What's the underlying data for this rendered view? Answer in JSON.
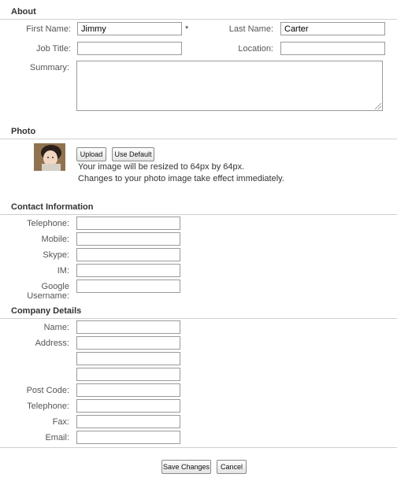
{
  "about": {
    "title": "About",
    "first_name_label": "First Name:",
    "first_name_value": "Jimmy",
    "required_mark": "*",
    "last_name_label": "Last Name:",
    "last_name_value": "Carter",
    "job_title_label": "Job Title:",
    "location_label": "Location:",
    "summary_label": "Summary:"
  },
  "photo": {
    "title": "Photo",
    "upload_label": "Upload",
    "use_default_label": "Use Default",
    "note1": "Your image will be resized to 64px by 64px.",
    "note2": "Changes to your photo image take effect immediately."
  },
  "contact": {
    "title": "Contact Information",
    "telephone_label": "Telephone:",
    "mobile_label": "Mobile:",
    "skype_label": "Skype:",
    "im_label": "IM:",
    "google_label": "Google Username:"
  },
  "company": {
    "title": "Company Details",
    "name_label": "Name:",
    "address_label": "Address:",
    "postcode_label": "Post Code:",
    "telephone_label": "Telephone:",
    "fax_label": "Fax:",
    "email_label": "Email:"
  },
  "actions": {
    "save_label": "Save Changes",
    "cancel_label": "Cancel"
  }
}
